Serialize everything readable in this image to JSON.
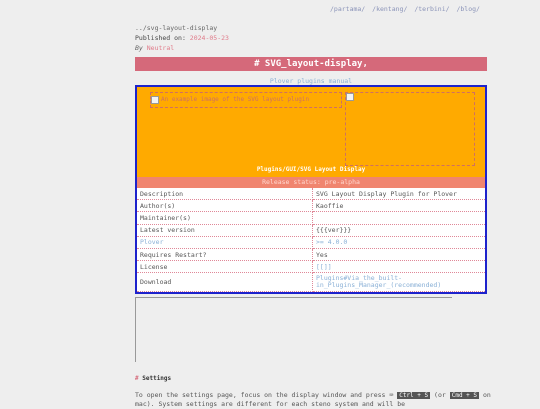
{
  "nav": [
    "/partama/",
    "/kentang/",
    "/terbini/",
    "/blog/"
  ],
  "meta": {
    "path": "../svg-layout-display",
    "published_label": "Published on:",
    "published_date": "2024-05-23",
    "by_label": "By",
    "author": "Neutral"
  },
  "title": "# SVG_layout-display,",
  "manual_link": "Plover plugins manual",
  "hero": {
    "image_alt": "An example image of the SVG layout plugin",
    "caption": "Plugins/GUI/SVG Layout Display"
  },
  "table": {
    "header": "Release status: pre-alpha",
    "rows": [
      {
        "key": "Description",
        "value": "SVG Layout Display Plugin for Plover"
      },
      {
        "key": "Author(s)",
        "value": "Kaoffie"
      },
      {
        "key": "Maintainer(s)",
        "value": ""
      },
      {
        "key": "Latest version",
        "value": "{{{ver}}}"
      },
      {
        "key": "Plover",
        "value": ">= 4.0.0"
      },
      {
        "key": "Requires Restart?",
        "value": "Yes"
      },
      {
        "key": "License",
        "value": "[[]]"
      },
      {
        "key": "Download",
        "value": "Plugins#Via_the_built-in_Plugins_Manager_(recommended)"
      }
    ]
  },
  "settings": {
    "hash": "#",
    "heading": "Settings",
    "para_start": "To open the settings page, focus on the display window and press",
    "kbd1": "Ctrl + S",
    "or": "(or",
    "kbd2": "Cmd + S",
    "para_end": "on mac). System settings are different for each steno system and will be"
  }
}
